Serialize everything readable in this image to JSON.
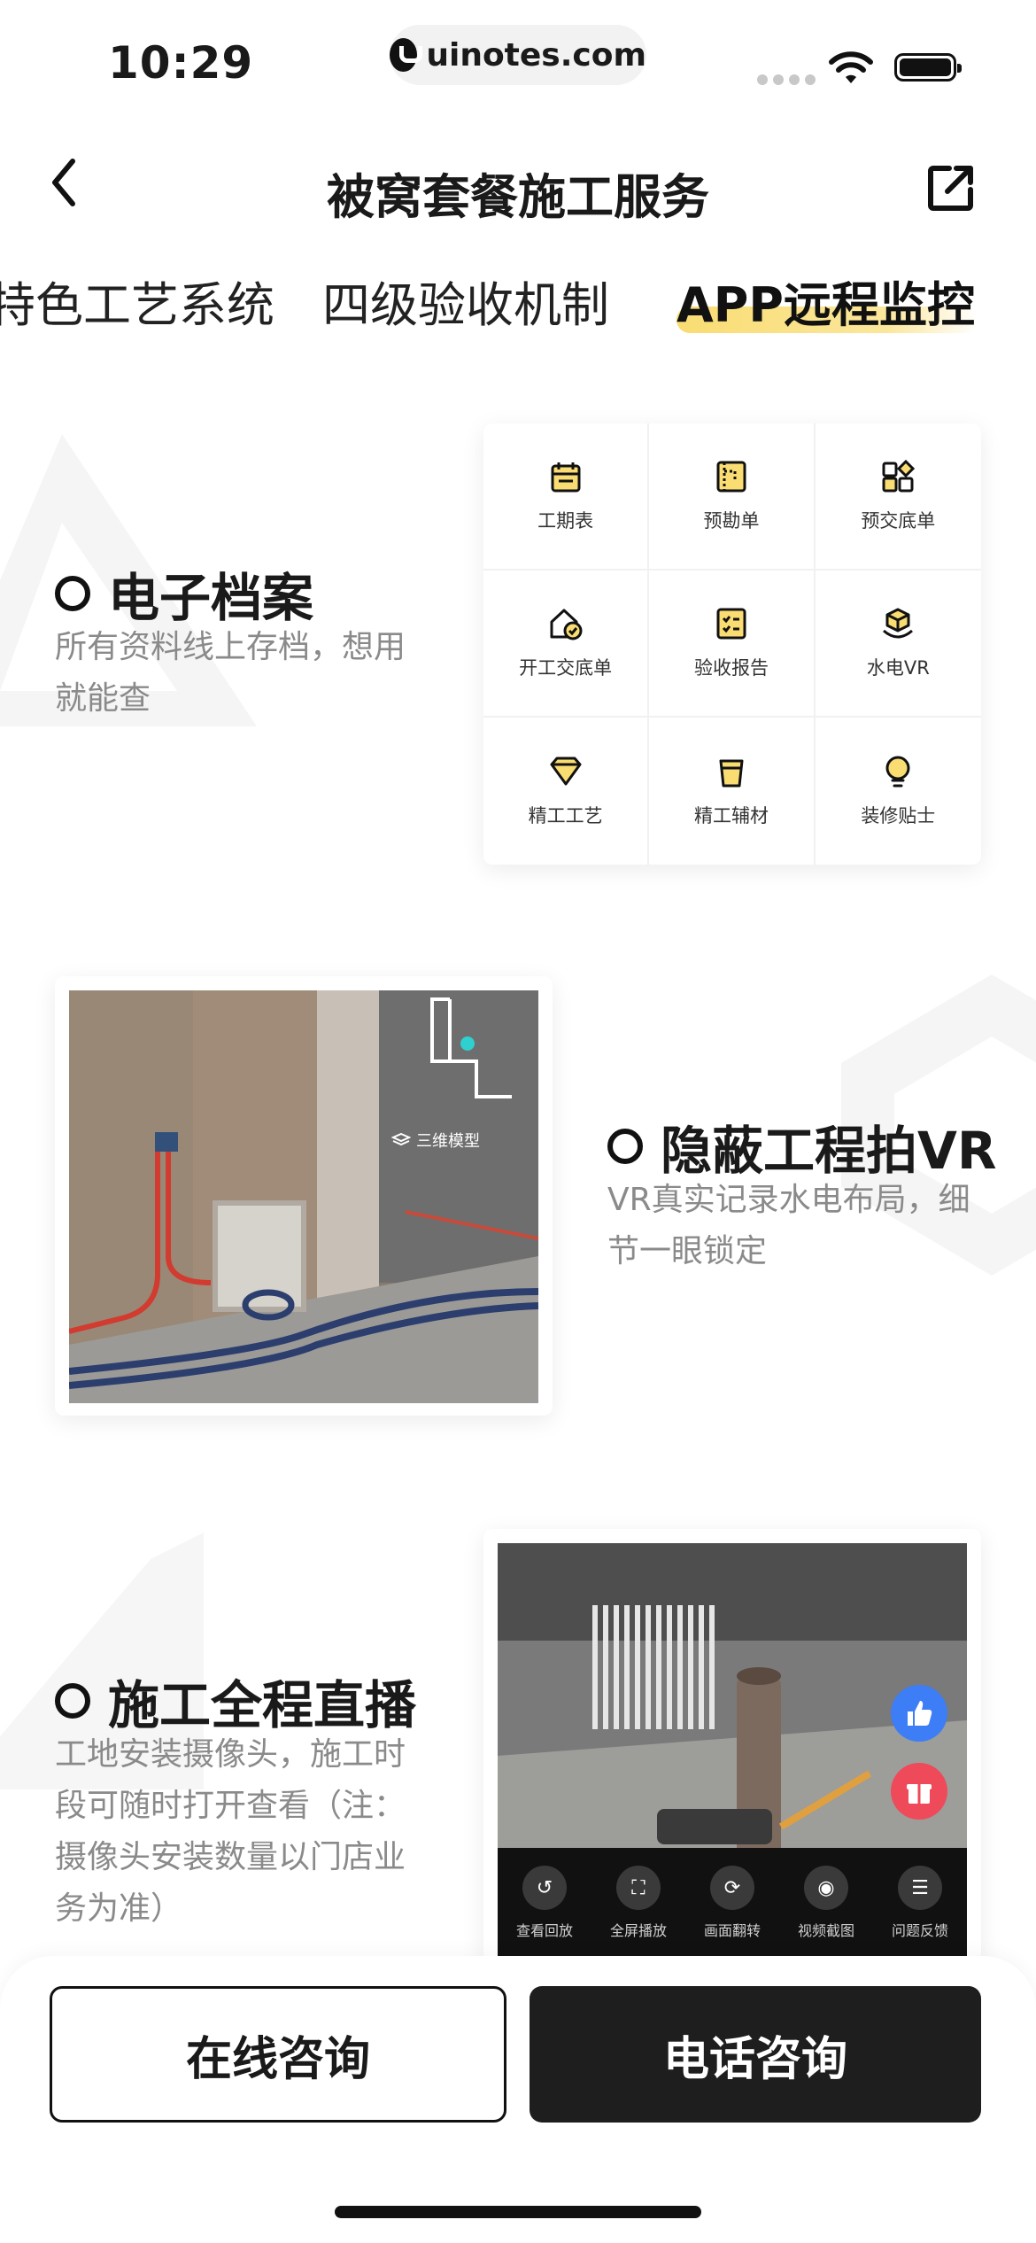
{
  "status_bar": {
    "time": "10:29",
    "url": "uinotes.com"
  },
  "header": {
    "title": "被窝套餐施工服务"
  },
  "tabs": [
    {
      "label": "特色工艺系统",
      "active": false
    },
    {
      "label": "四级验收机制",
      "active": false
    },
    {
      "label": "APP远程监控",
      "active": true
    }
  ],
  "features": [
    {
      "title": "电子档案",
      "desc_lines": [
        "所有资料线上存档，想用",
        "就能查"
      ]
    },
    {
      "title": "隐蔽工程拍VR",
      "desc_lines": [
        "VR真实记录水电布局，细",
        "节一眼锁定"
      ]
    },
    {
      "title": "施工全程直播",
      "desc_lines": [
        "工地安装摄像头，施工时",
        "段可随时打开查看（注：",
        "摄像头安装数量以门店业",
        "务为准）"
      ]
    }
  ],
  "grid_items": [
    {
      "label": "工期表",
      "icon": "calendar-icon"
    },
    {
      "label": "预勘单",
      "icon": "blueprint-icon"
    },
    {
      "label": "预交底单",
      "icon": "shapes-icon"
    },
    {
      "label": "开工交底单",
      "icon": "house-check-icon"
    },
    {
      "label": "验收报告",
      "icon": "checklist-icon"
    },
    {
      "label": "水电VR",
      "icon": "cube-icon"
    },
    {
      "label": "精工工艺",
      "icon": "gem-icon"
    },
    {
      "label": "精工辅材",
      "icon": "bucket-icon"
    },
    {
      "label": "装修贴士",
      "icon": "bulb-icon"
    }
  ],
  "vr_overlay": {
    "label": "三维模型"
  },
  "live_controls": [
    {
      "label": "查看回放",
      "icon": "replay-icon"
    },
    {
      "label": "全屏播放",
      "icon": "fullscreen-icon"
    },
    {
      "label": "画面翻转",
      "icon": "rotate-icon"
    },
    {
      "label": "视频截图",
      "icon": "camera-icon"
    },
    {
      "label": "问题反馈",
      "icon": "feedback-icon"
    }
  ],
  "bottom": {
    "online_label": "在线咨询",
    "phone_label": "电话咨询"
  },
  "colors": {
    "accent_yellow": "#f9dc72",
    "dark": "#1e1e1e",
    "muted": "#8a8a8a",
    "like_blue": "#3d7df5",
    "gift_red": "#ef4a5a"
  }
}
